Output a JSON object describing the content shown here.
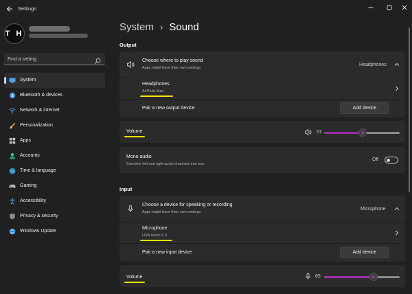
{
  "window": {
    "title": "Settings"
  },
  "user": {
    "initials": "T H"
  },
  "search": {
    "placeholder": "Find a setting"
  },
  "sidebar": {
    "items": [
      {
        "label": "System",
        "icon": "system-icon",
        "active": true
      },
      {
        "label": "Bluetooth & devices",
        "icon": "bluetooth-icon"
      },
      {
        "label": "Network & internet",
        "icon": "wifi-icon"
      },
      {
        "label": "Personalization",
        "icon": "brush-icon"
      },
      {
        "label": "Apps",
        "icon": "apps-icon"
      },
      {
        "label": "Accounts",
        "icon": "person-icon"
      },
      {
        "label": "Time & language",
        "icon": "globe-icon"
      },
      {
        "label": "Gaming",
        "icon": "gamepad-icon"
      },
      {
        "label": "Accessibility",
        "icon": "accessibility-icon"
      },
      {
        "label": "Privacy & security",
        "icon": "shield-icon"
      },
      {
        "label": "Windows Update",
        "icon": "update-icon"
      }
    ]
  },
  "breadcrumb": {
    "parent": "System",
    "separator": "›",
    "current": "Sound"
  },
  "output": {
    "heading": "Output",
    "choose": {
      "title": "Choose where to play sound",
      "subtitle": "Apps might have their own settings",
      "selected": "Headphones"
    },
    "device": {
      "name": "Headphones",
      "detail": "AirPods Max"
    },
    "pair": {
      "label": "Pair a new output device",
      "button": "Add device"
    },
    "volume": {
      "label": "Volume",
      "value": "51",
      "level": 51
    },
    "mono": {
      "title": "Mono audio",
      "subtitle": "Combine left and right audio channels into one",
      "state": "Off"
    }
  },
  "input": {
    "heading": "Input",
    "choose": {
      "title": "Choose a device for speaking or recording",
      "subtitle": "Apps might have their own settings",
      "selected": "Microphone"
    },
    "device": {
      "name": "Microphone",
      "detail": "USB Audio 2.0"
    },
    "pair": {
      "label": "Pair a new input device",
      "button": "Add device"
    },
    "volume": {
      "label": "Volume",
      "value": "65",
      "level": 65
    }
  },
  "colors": {
    "accent": "#9c2ea8",
    "highlight": "#f5e10a",
    "background": "#202020",
    "card": "#2b2b2b"
  }
}
